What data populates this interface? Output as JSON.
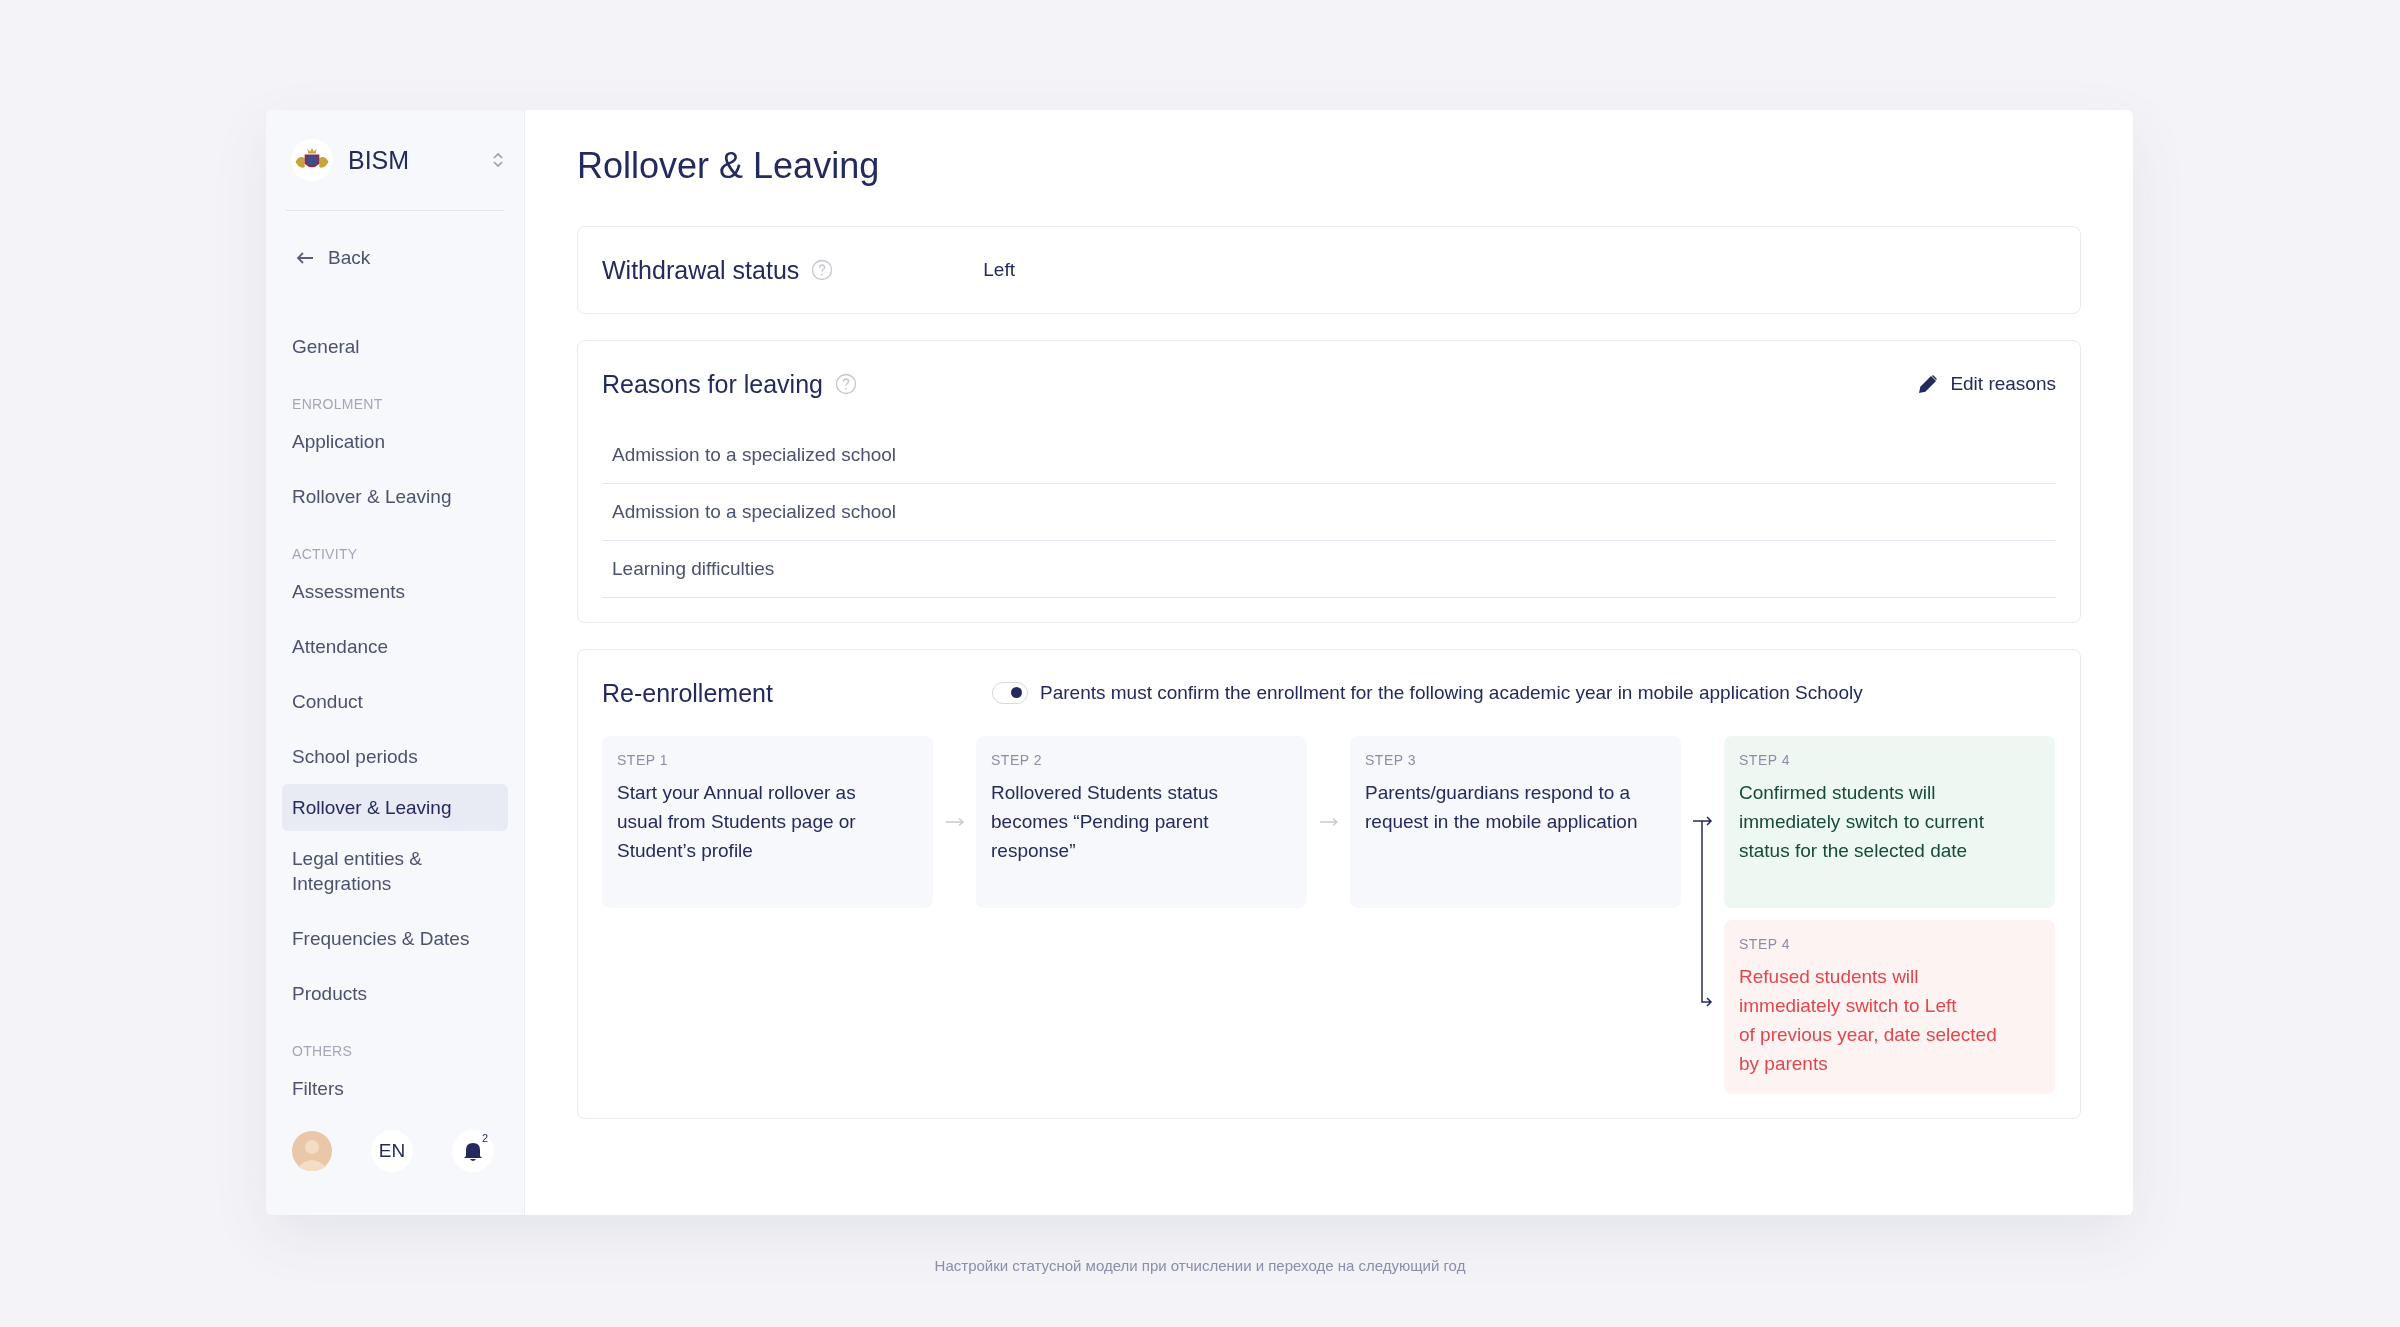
{
  "sidebar": {
    "school": "BISM",
    "back": "Back",
    "nav": [
      {
        "kind": "item",
        "label": "General",
        "selected": false
      },
      {
        "kind": "section",
        "label": "ENROLMENT"
      },
      {
        "kind": "item",
        "label": "Application",
        "selected": false
      },
      {
        "kind": "item",
        "label": "Rollover & Leaving",
        "selected": false
      },
      {
        "kind": "section",
        "label": "ACTIVITY"
      },
      {
        "kind": "item",
        "label": "Assessments",
        "selected": false
      },
      {
        "kind": "item",
        "label": "Attendance",
        "selected": false
      },
      {
        "kind": "item",
        "label": "Conduct",
        "selected": false
      },
      {
        "kind": "item",
        "label": "School periods",
        "selected": false
      },
      {
        "kind": "item",
        "label": "Rollover & Leaving",
        "selected": true
      },
      {
        "kind": "item",
        "label": "Legal entities & Integrations",
        "selected": false
      },
      {
        "kind": "item",
        "label": "Frequencies & Dates",
        "selected": false
      },
      {
        "kind": "item",
        "label": "Products",
        "selected": false
      },
      {
        "kind": "section",
        "label": "OTHERS"
      },
      {
        "kind": "item",
        "label": "Filters",
        "selected": false
      }
    ],
    "footer": {
      "language": "EN",
      "notifications": "2"
    }
  },
  "page": {
    "title": "Rollover & Leaving"
  },
  "withdrawal": {
    "label": "Withdrawal status",
    "value": "Left"
  },
  "reasons": {
    "title": "Reasons for leaving",
    "edit": "Edit reasons",
    "items": [
      "Admission to a specialized school",
      "Admission to a specialized school",
      "Learning difficulties"
    ]
  },
  "reenrollment": {
    "title": "Re-enrollement",
    "toggle": {
      "on": true,
      "label": "Parents must confirm the enrollment for the following academic year in mobile application Schooly"
    },
    "steps": [
      {
        "label": "STEP 1",
        "text": "Start your Annual rollover as usual from Students page or Student’s profile"
      },
      {
        "label": "STEP 2",
        "text": "Rollovered Students status becomes “Pending parent response”"
      },
      {
        "label": "STEP 3",
        "text": "Parents/guardians respond to a request in the mobile application"
      }
    ],
    "outcomes": [
      {
        "kind": "success",
        "label": "STEP 4",
        "text": "Confirmed students will immediately switch to current status for the selected date"
      },
      {
        "kind": "danger",
        "label": "STEP 4",
        "text": "Refused students will immediately switch to Left\nof previous year, date selected by parents"
      }
    ]
  },
  "caption": "Настройки статусной модели при отчислении и переходе на следующий год"
}
